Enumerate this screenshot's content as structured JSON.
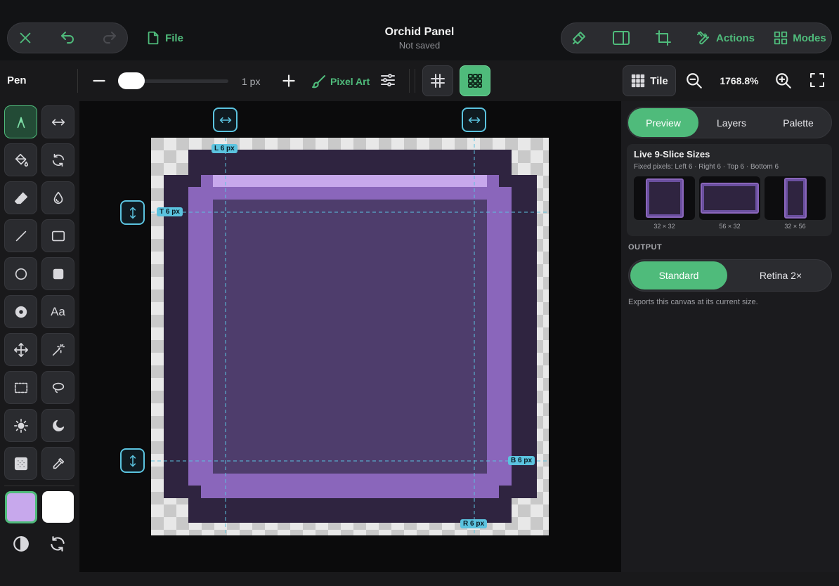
{
  "app": {
    "title": "Orchid Panel",
    "status": "Not saved"
  },
  "topbar": {
    "file_label": "File",
    "actions_label": "Actions",
    "modes_label": "Modes",
    "accent": "#4fbb7b"
  },
  "toolbar": {
    "tool_name": "Pen",
    "brush_size": "1 px",
    "brush_size_value": 1,
    "brush_slider_fraction": 0.05,
    "brush_mode": "Pixel Art",
    "tile_label": "Tile",
    "zoom": "1768.8%"
  },
  "tools": [
    {
      "name": "pen-tool",
      "icon": "pen-icon",
      "active": true
    },
    {
      "name": "mirror-tool",
      "icon": "arrows-horizontal-icon",
      "active": false
    },
    {
      "name": "fill-tool",
      "icon": "paint-bucket-icon",
      "active": false
    },
    {
      "name": "rotate-tool",
      "icon": "rotate-icon",
      "active": false
    },
    {
      "name": "eraser-tool",
      "icon": "eraser-icon",
      "active": false
    },
    {
      "name": "blur-tool",
      "icon": "drop-icon",
      "active": false
    },
    {
      "name": "line-tool",
      "icon": "line-icon",
      "active": false
    },
    {
      "name": "rectangle-tool",
      "icon": "rectangle-icon",
      "active": false
    },
    {
      "name": "ellipse-tool",
      "icon": "circle-icon",
      "active": false
    },
    {
      "name": "filled-rectangle-tool",
      "icon": "filled-square-icon",
      "active": false
    },
    {
      "name": "filled-ellipse-tool",
      "icon": "filled-circle-icon",
      "active": false
    },
    {
      "name": "text-tool",
      "icon": "text-icon",
      "label": "Aa",
      "active": false
    },
    {
      "name": "move-tool",
      "icon": "move-icon",
      "active": false
    },
    {
      "name": "magic-wand-tool",
      "icon": "magic-wand-icon",
      "active": false
    },
    {
      "name": "select-rect-tool",
      "icon": "dashed-rect-icon",
      "active": false
    },
    {
      "name": "lasso-tool",
      "icon": "lasso-icon",
      "active": false
    },
    {
      "name": "lighten-tool",
      "icon": "sun-icon",
      "active": false
    },
    {
      "name": "darken-tool",
      "icon": "moon-icon",
      "active": false
    },
    {
      "name": "dither-tool",
      "icon": "checker-icon",
      "active": false
    },
    {
      "name": "eyedropper-tool",
      "icon": "eyedropper-icon",
      "active": false
    }
  ],
  "colors": {
    "primary": "#c7a8ec",
    "secondary": "#ffffff"
  },
  "guides": {
    "left": "L 6 px",
    "top": "T 6 px",
    "bottom": "B 6 px",
    "right": "R 6 px"
  },
  "panel": {
    "tabs": [
      "Preview",
      "Layers",
      "Palette"
    ],
    "active_tab": "Preview",
    "slice_title": "Live 9-Slice Sizes",
    "slice_desc": "Fixed pixels: Left 6 · Right 6 · Top 6 · Bottom 6",
    "previews": [
      "32 × 32",
      "56 × 32",
      "32 × 56"
    ],
    "output_label": "OUTPUT",
    "output_options": [
      "Standard",
      "Retina 2×"
    ],
    "output_selected": "Standard",
    "export_note": "Exports this canvas at its current size."
  }
}
